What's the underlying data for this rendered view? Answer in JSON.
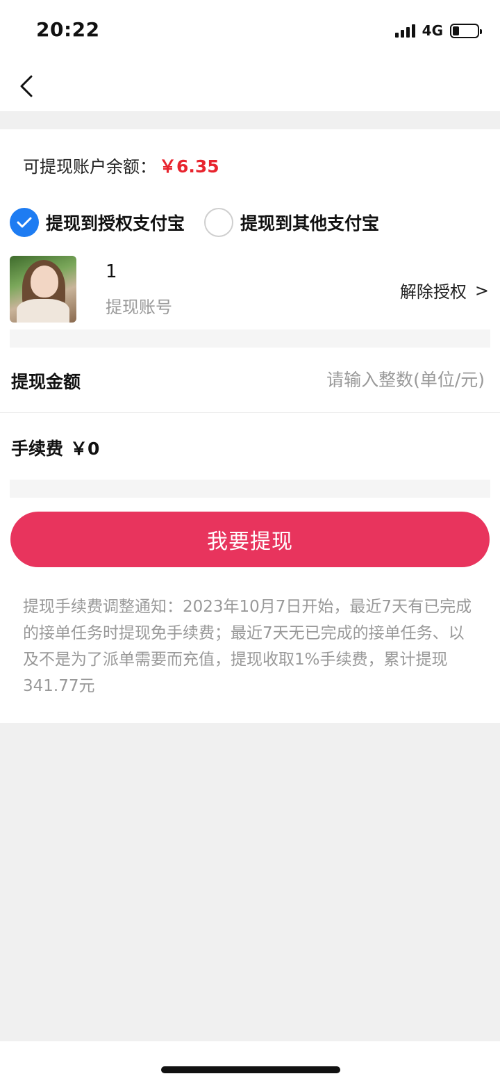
{
  "status_bar": {
    "time": "20:22",
    "network": "4G",
    "battery_level_percent": 25
  },
  "nav": {
    "back_icon": "chevron-left-icon"
  },
  "balance": {
    "label": "可提现账户余额：",
    "value": "￥6.35",
    "color": "#e8242e"
  },
  "options": [
    {
      "label": "提现到授权支付宝",
      "checked": true
    },
    {
      "label": "提现到其他支付宝",
      "checked": false
    }
  ],
  "account": {
    "name": "1",
    "label": "提现账号",
    "unbind_label": "解除授权",
    "unbind_arrow": ">"
  },
  "amount": {
    "label": "提现金额",
    "placeholder": "请输入整数(单位/元)"
  },
  "fee": {
    "label": "手续费",
    "value": "￥0"
  },
  "submit": {
    "label": "我要提现",
    "color": "#e8345d"
  },
  "notice": {
    "text": "提现手续费调整通知：2023年10月7日开始，最近7天有已完成的接单任务时提现免手续费；最近7天无已完成的接单任务、以及不是为了派单需要而充值，提现收取1%手续费，累计提现341.77元"
  },
  "accent_color": "#1e7cf2"
}
